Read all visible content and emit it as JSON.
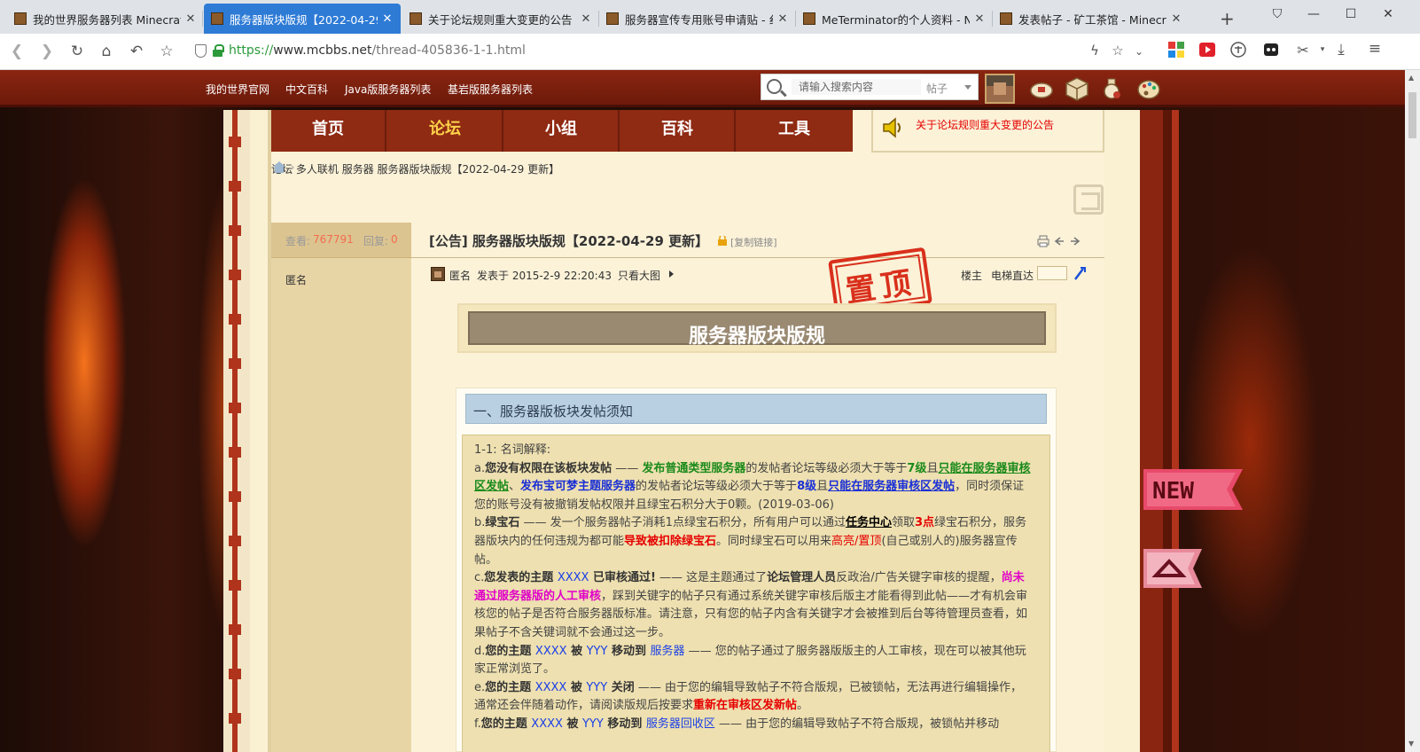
{
  "browser": {
    "tabs": [
      {
        "title": "我的世界服务器列表 Minecraft",
        "active": false
      },
      {
        "title": "服务器版块版规【2022-04-29",
        "active": true
      },
      {
        "title": "关于论坛规则重大变更的公告 -",
        "active": false
      },
      {
        "title": "服务器宣传专用账号申请贴 - 纟",
        "active": false
      },
      {
        "title": "MeTerminator的个人资料 - N",
        "active": false
      },
      {
        "title": "发表帖子 - 矿工茶馆 - Minecra",
        "active": false
      }
    ],
    "url_scheme": "https://",
    "url_host": "www.mcbbs.net",
    "url_path": "/thread-405836-1-1.html"
  },
  "site": {
    "top_links": [
      "我的世界官网",
      "中文百科",
      "Java版服务器列表",
      "基岩版服务器列表"
    ],
    "search_placeholder": "请输入搜索内容",
    "search_scope": "帖子",
    "nav": [
      "首页",
      "论坛",
      "小组",
      "百科",
      "工具"
    ],
    "notice": "关于论坛规则重大变更的公告",
    "breadcrumb": [
      "论坛",
      "多人联机",
      "服务器",
      "服务器版块版规【2022-04-29 更新】"
    ]
  },
  "thread": {
    "views_label": "查看:",
    "views": "767791",
    "replies_label": "回复:",
    "replies": "0",
    "title": "[公告] 服务器版块版规【2022-04-29 更新】",
    "copy_link": "[复制链接]",
    "author": "匿名",
    "post_author": "匿名",
    "post_time": "发表于 2015-2-9 22:20:43",
    "only_big": "只看大图",
    "floor": "楼主",
    "jump": "电梯直达",
    "stamp": "置顶"
  },
  "content": {
    "banner_title": "服务器版块版规",
    "section1_title": "一、服务器版板块发帖须知"
  },
  "colors": {
    "tab_active": "#2e7bd6",
    "topbar": "#8a2511",
    "nav_bg": "#8f2a13",
    "nav_current": "#ffd34a",
    "parchment": "#fbf2d8",
    "stamp": "#d9301c"
  }
}
